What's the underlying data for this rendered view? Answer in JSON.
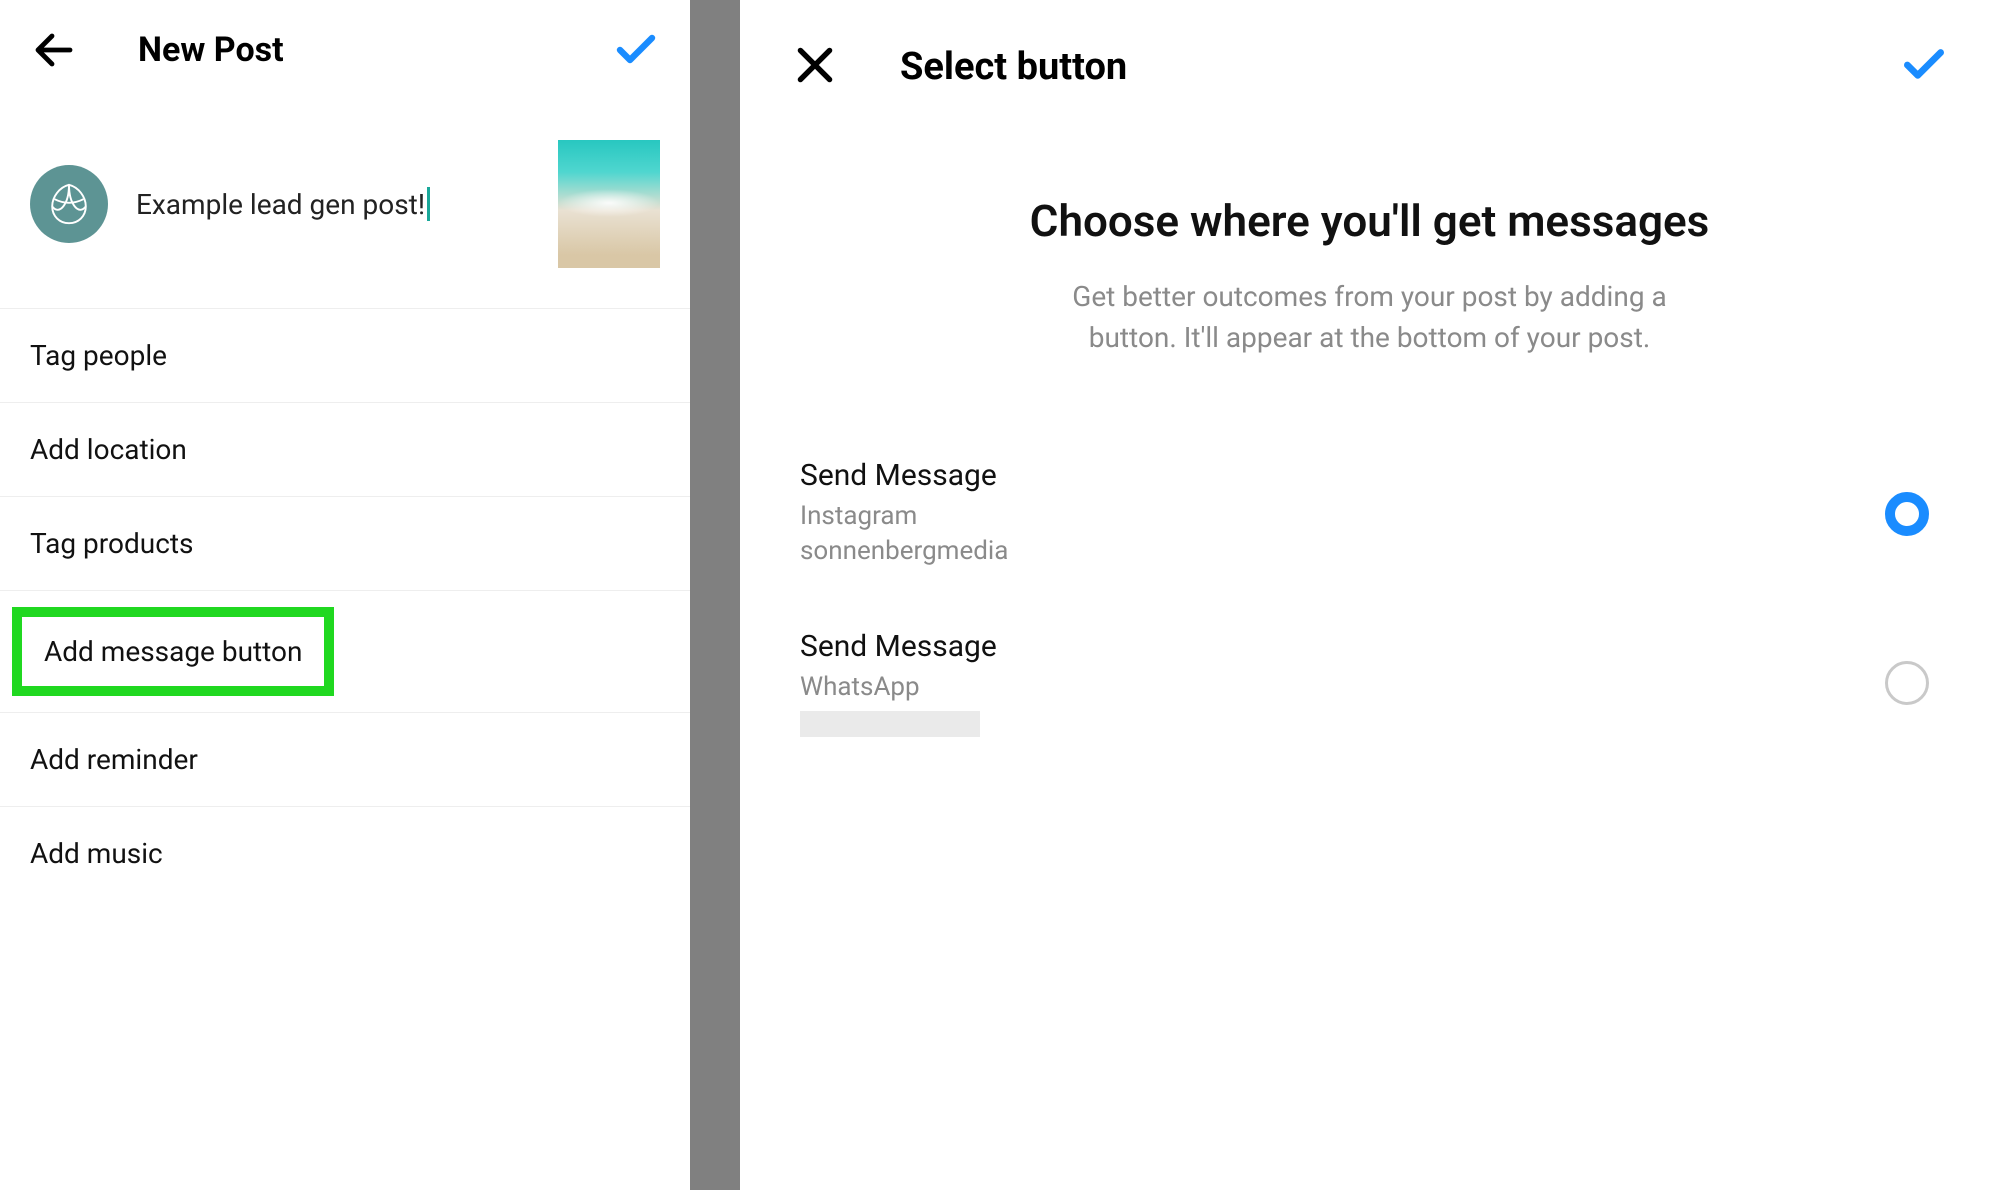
{
  "left": {
    "title": "New Post",
    "caption": "Example lead gen post!",
    "rows": {
      "tag_people": "Tag people",
      "add_location": "Add location",
      "tag_products": "Tag products",
      "add_message_button": "Add message button",
      "add_reminder": "Add reminder",
      "add_music": "Add music"
    }
  },
  "right": {
    "title": "Select button",
    "heading": "Choose where you'll get messages",
    "subtext": "Get better outcomes from your post by adding a button. It'll appear at the bottom of your post.",
    "choices": [
      {
        "title": "Send Message",
        "platform": "Instagram",
        "account": "sonnenbergmedia",
        "selected": true
      },
      {
        "title": "Send Message",
        "platform": "WhatsApp",
        "account": "",
        "selected": false
      }
    ]
  },
  "colors": {
    "accent_blue": "#1a8cff",
    "highlight_green": "#20d820"
  }
}
